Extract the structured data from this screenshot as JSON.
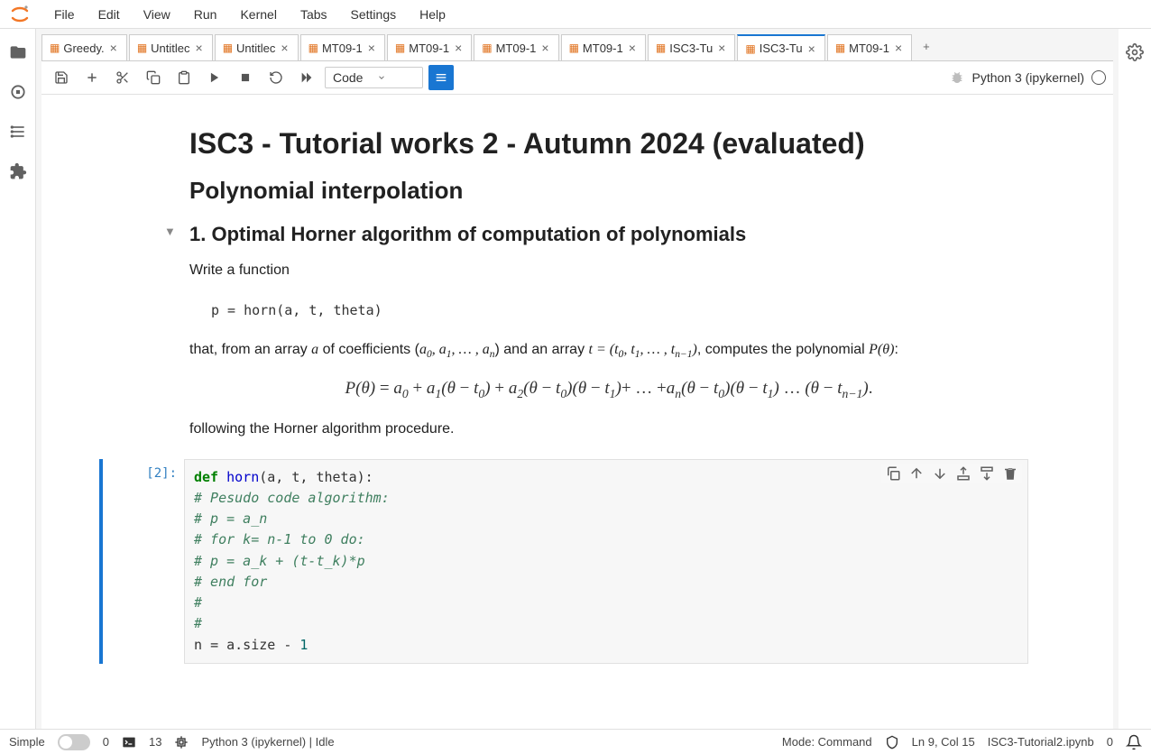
{
  "menu": {
    "file": "File",
    "edit": "Edit",
    "view": "View",
    "run": "Run",
    "kernel": "Kernel",
    "tabs": "Tabs",
    "settings": "Settings",
    "help": "Help"
  },
  "tabs": [
    {
      "label": "Greedy."
    },
    {
      "label": "Untitlec"
    },
    {
      "label": "Untitlec"
    },
    {
      "label": "MT09-1"
    },
    {
      "label": "MT09-1"
    },
    {
      "label": "MT09-1"
    },
    {
      "label": "MT09-1"
    },
    {
      "label": "ISC3-Tu"
    },
    {
      "label": "ISC3-Tu"
    },
    {
      "label": "MT09-1"
    }
  ],
  "active_tab_index": 8,
  "toolbar": {
    "cell_type": "Code"
  },
  "kernel": {
    "name": "Python 3 (ipykernel)"
  },
  "document": {
    "h1": "ISC3 - Tutorial works 2 - Autumn 2024 (evaluated)",
    "h2": "Polynomial interpolation",
    "h3": "1. Optimal Horner algorithm of computation of polynomials",
    "p1": "Write a function",
    "codeline": "p = horn(a, t, theta)",
    "p2_pre": "that, from an array ",
    "p2_a": "a",
    "p2_mid": " of coefficients (",
    "p2_coeffs": "a₀, a₁, … , aₙ",
    "p2_mid2": ") and an array ",
    "p2_t": "t = (t₀, t₁, … , tₙ₋₁)",
    "p2_post": ", computes the polynomial ",
    "p2_P": "P(θ)",
    "p2_end": ":",
    "formula": "P(θ) = a₀ + a₁(θ − t₀) + a₂(θ − t₀)(θ − t₁) + … + aₙ(θ − t₀)(θ − t₁) … (θ − tₙ₋₁).",
    "p3": "following the Horner algorithm procedure."
  },
  "cell": {
    "prompt": "[2]:",
    "code": {
      "l1_kw": "def ",
      "l1_fn": "horn",
      "l1_rest": "(a, t, theta):",
      "l2": "    # Pesudo code algorithm:",
      "l3": "    # p = a_n",
      "l4": "    # for k= n-1 to 0 do:",
      "l5": "    #    p = a_k + (t-t_k)*p",
      "l6": "    # end for",
      "l7": "    #",
      "l8": "    #",
      "l9a": "    n ",
      "l9b": "=",
      "l9c": " a.size ",
      "l9d": "-",
      "l9e": " 1"
    }
  },
  "status": {
    "simple": "Simple",
    "n0": "0",
    "n13": "13",
    "kernel": "Python 3 (ipykernel) | Idle",
    "mode": "Mode: Command",
    "ln": "Ln 9, Col 15",
    "file": "ISC3-Tutorial2.ipynb",
    "n0b": "0"
  }
}
